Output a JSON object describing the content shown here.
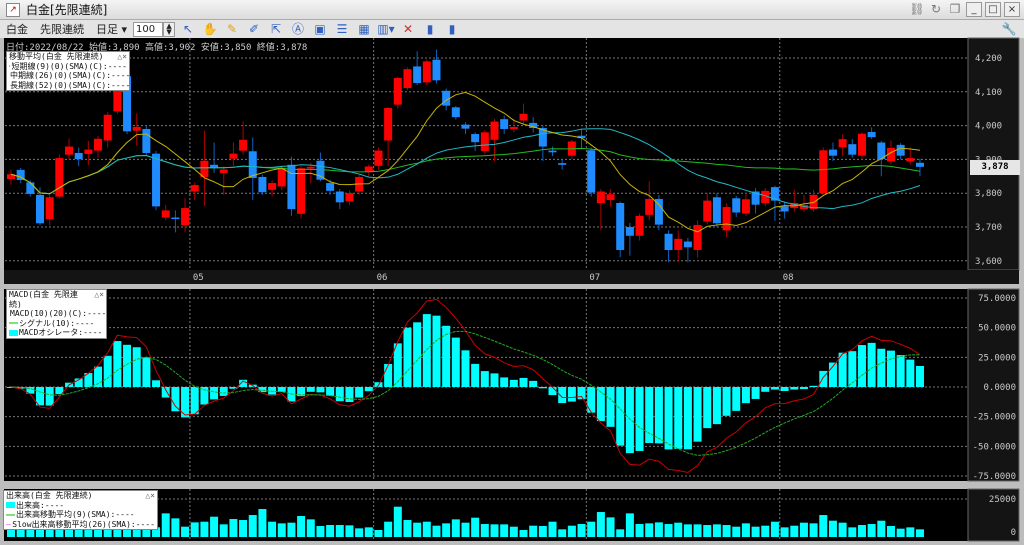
{
  "window": {
    "title": "白金[先限連続]"
  },
  "toolbar": {
    "commodity": "白金",
    "contract": "先限連続",
    "period": "日足",
    "count": "100"
  },
  "info": "日付:2022/08/22 始値:3,890 高値:3,902 安値:3,850 終値:3,878",
  "last_price": "3,878",
  "colors": {
    "up": "#ff0000",
    "down": "#1e8cff",
    "ma_short": "#c8b400",
    "ma_mid": "#20b8c8",
    "ma_long": "#22bb22",
    "macd": "#cc0000",
    "signal": "#22aa22",
    "osc": "#00ffff",
    "volume": "#00ffff"
  },
  "legends": {
    "ma": {
      "title": "移動平均(白金 先限連続)",
      "items": [
        "短期線(9)(0)(SMA)(C):----",
        "中期線(26)(0)(SMA)(C):----",
        "長期線(52)(0)(SMA)(C):----"
      ]
    },
    "macd": {
      "title": "MACD(白金 先限連続)",
      "items": [
        "MACD(10)(20)(C):----",
        "シグナル(10):----",
        "MACDオシレータ:----"
      ]
    },
    "vol": {
      "title": "出来高(白金 先限連続)",
      "items": [
        "出来高:----",
        "出来高移動平均(9)(SMA):----",
        "Slow出来高移動平均(26)(SMA):----"
      ]
    }
  },
  "chart_data": [
    {
      "type": "candlestick",
      "title": "白金[先限連続] 日足",
      "ylim": [
        3550,
        4250
      ],
      "yticks": [
        "4,200",
        "4,100",
        "4,000",
        "3,900",
        "3,800",
        "3,700",
        "3,600"
      ],
      "ytick_values": [
        4200,
        4100,
        4000,
        3900,
        3800,
        3700,
        3600
      ],
      "months": [
        {
          "label": "05",
          "index": 18.5
        },
        {
          "label": "06",
          "index": 37.5
        },
        {
          "label": "07",
          "index": 59.5
        },
        {
          "label": "08",
          "index": 79.5
        }
      ],
      "ma_periods": [
        9,
        26,
        52
      ],
      "ohlc": [
        [
          3842,
          3870,
          3825,
          3856
        ],
        [
          3869,
          3875,
          3830,
          3839
        ],
        [
          3832,
          3838,
          3790,
          3798
        ],
        [
          3795,
          3818,
          3705,
          3711
        ],
        [
          3723,
          3795,
          3705,
          3788
        ],
        [
          3790,
          3915,
          3785,
          3904
        ],
        [
          3914,
          3962,
          3900,
          3938
        ],
        [
          3919,
          3935,
          3880,
          3901
        ],
        [
          3916,
          3955,
          3883,
          3929
        ],
        [
          3926,
          3970,
          3905,
          3961
        ],
        [
          3956,
          4040,
          3935,
          4032
        ],
        [
          4042,
          4125,
          4035,
          4116
        ],
        [
          4146,
          4215,
          3975,
          3983
        ],
        [
          3985,
          4036,
          3940,
          3996
        ],
        [
          3990,
          4000,
          3912,
          3919
        ],
        [
          3917,
          3925,
          3750,
          3761
        ],
        [
          3728,
          3765,
          3720,
          3749
        ],
        [
          3728,
          3749,
          3684,
          3727
        ],
        [
          3705,
          3786,
          3684,
          3756
        ],
        [
          3805,
          3832,
          3780,
          3824
        ],
        [
          3848,
          3985,
          3762,
          3896
        ],
        [
          3884,
          3950,
          3860,
          3874
        ],
        [
          3860,
          3880,
          3795,
          3870
        ],
        [
          3902,
          3950,
          3880,
          3917
        ],
        [
          3926,
          4013,
          3915,
          3958
        ],
        [
          3924,
          3965,
          3780,
          3845
        ],
        [
          3848,
          3855,
          3795,
          3803
        ],
        [
          3810,
          3838,
          3790,
          3830
        ],
        [
          3820,
          3882,
          3808,
          3874
        ],
        [
          3884,
          3908,
          3733,
          3753
        ],
        [
          3739,
          3880,
          3725,
          3874
        ],
        [
          3873,
          3890,
          3830,
          3878
        ],
        [
          3896,
          3920,
          3835,
          3840
        ],
        [
          3830,
          3840,
          3795,
          3807
        ],
        [
          3805,
          3812,
          3753,
          3773
        ],
        [
          3776,
          3808,
          3765,
          3800
        ],
        [
          3805,
          3855,
          3795,
          3848
        ],
        [
          3862,
          3885,
          3850,
          3879
        ],
        [
          3881,
          3935,
          3870,
          3926
        ],
        [
          3956,
          4055,
          3880,
          4052
        ],
        [
          4062,
          4145,
          4050,
          4141
        ],
        [
          4111,
          4172,
          4105,
          4167
        ],
        [
          4175,
          4220,
          4120,
          4126
        ],
        [
          4128,
          4195,
          4120,
          4190
        ],
        [
          4195,
          4225,
          4125,
          4134
        ],
        [
          4103,
          4110,
          4045,
          4059
        ],
        [
          4054,
          4058,
          4018,
          4025
        ],
        [
          4003,
          4010,
          3975,
          3991
        ],
        [
          3975,
          3980,
          3925,
          3951
        ],
        [
          3925,
          3987,
          3915,
          3980
        ],
        [
          3958,
          4020,
          3895,
          4012
        ],
        [
          4019,
          4030,
          3975,
          3990
        ],
        [
          3990,
          4020,
          3980,
          3996
        ],
        [
          4015,
          4065,
          4005,
          4035
        ],
        [
          4008,
          4025,
          3980,
          3993
        ],
        [
          3993,
          4000,
          3895,
          3938
        ],
        [
          3926,
          3938,
          3910,
          3921
        ],
        [
          3889,
          3900,
          3870,
          3884
        ],
        [
          3911,
          3958,
          3900,
          3953
        ],
        [
          3970,
          3990,
          3930,
          3963
        ],
        [
          3927,
          3935,
          3790,
          3802
        ],
        [
          3771,
          3812,
          3690,
          3805
        ],
        [
          3780,
          3812,
          3760,
          3797
        ],
        [
          3771,
          3775,
          3610,
          3632
        ],
        [
          3700,
          3712,
          3615,
          3674
        ],
        [
          3674,
          3740,
          3660,
          3733
        ],
        [
          3736,
          3835,
          3720,
          3783
        ],
        [
          3783,
          3795,
          3690,
          3707
        ],
        [
          3680,
          3690,
          3596,
          3632
        ],
        [
          3632,
          3690,
          3596,
          3665
        ],
        [
          3657,
          3668,
          3596,
          3640
        ],
        [
          3632,
          3720,
          3610,
          3706
        ],
        [
          3716,
          3800,
          3708,
          3778
        ],
        [
          3788,
          3800,
          3700,
          3711
        ],
        [
          3690,
          3770,
          3670,
          3759
        ],
        [
          3785,
          3792,
          3730,
          3743
        ],
        [
          3740,
          3800,
          3733,
          3782
        ],
        [
          3805,
          3815,
          3740,
          3766
        ],
        [
          3771,
          3815,
          3762,
          3807
        ],
        [
          3818,
          3822,
          3718,
          3778
        ],
        [
          3761,
          3775,
          3725,
          3746
        ],
        [
          3756,
          3810,
          3745,
          3771
        ],
        [
          3753,
          3795,
          3745,
          3765
        ],
        [
          3753,
          3810,
          3745,
          3795
        ],
        [
          3800,
          3935,
          3795,
          3927
        ],
        [
          3929,
          3950,
          3895,
          3911
        ],
        [
          3936,
          3975,
          3910,
          3960
        ],
        [
          3945,
          3960,
          3905,
          3914
        ],
        [
          3911,
          3980,
          3900,
          3976
        ],
        [
          3981,
          3995,
          3960,
          3966
        ],
        [
          3950,
          3955,
          3850,
          3901
        ],
        [
          3894,
          3956,
          3885,
          3934
        ],
        [
          3943,
          3948,
          3900,
          3911
        ],
        [
          3894,
          3936,
          3885,
          3904
        ],
        [
          3890,
          3902,
          3850,
          3878
        ]
      ]
    },
    {
      "type": "macd",
      "fast": 10,
      "slow": 20,
      "signal": 10,
      "ylim": [
        -80,
        80
      ],
      "yticks": [
        "75.0000",
        "50.0000",
        "25.0000",
        "0.0000",
        "-25.0000",
        "-50.0000",
        "-75.0000"
      ],
      "ytick_values": [
        75,
        50,
        25,
        0,
        -25,
        -50,
        -75
      ]
    },
    {
      "type": "bar",
      "title": "出来高",
      "ylim": [
        0,
        27000
      ],
      "yticks": [
        "25000",
        "0"
      ],
      "ytick_values": [
        25000,
        0
      ],
      "values": [
        6000,
        5800,
        6200,
        5500,
        6400,
        5900,
        6100,
        5600,
        6300,
        5800,
        6000,
        6200,
        5700,
        6100,
        5900,
        6400,
        15550,
        12260,
        6790,
        9640,
        10070,
        13360,
        8320,
        11830,
        11170,
        14450,
        18400,
        10070,
        8980,
        9420,
        13800,
        11610,
        7230,
        7880,
        7880,
        7670,
        5690,
        6350,
        4600,
        10070,
        19930,
        11170,
        9420,
        10070,
        7450,
        8980,
        11610,
        9420,
        12700,
        8540,
        8320,
        8320,
        6790,
        4600,
        7450,
        7230,
        10070,
        5040,
        7450,
        8540,
        10070,
        16430,
        12920,
        5040,
        15550,
        8540,
        8980,
        9640,
        8540,
        9420,
        8320,
        8320,
        7880,
        8320,
        7880,
        6790,
        8980,
        6790,
        7450,
        10070,
        6350,
        7450,
        9420,
        8980,
        14450,
        10730,
        9420,
        6350,
        7880,
        8540,
        10730,
        7230,
        5480,
        6350,
        5040
      ]
    }
  ]
}
